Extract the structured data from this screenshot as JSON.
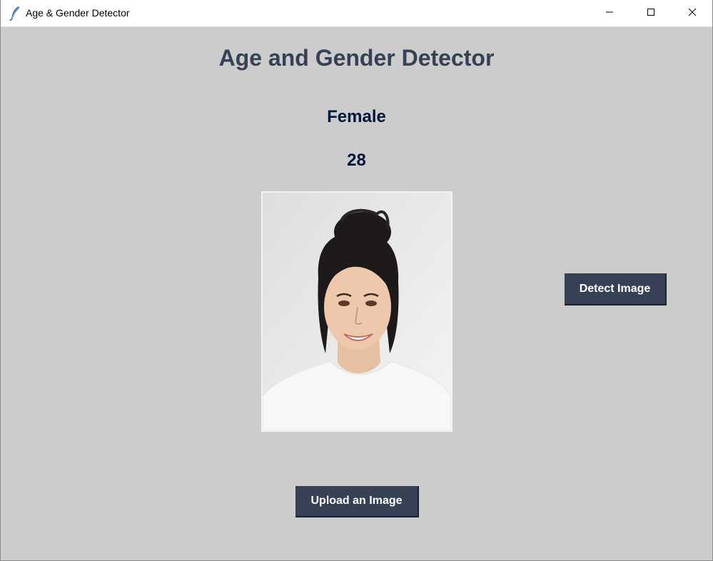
{
  "window": {
    "title": "Age & Gender Detector",
    "controls": {
      "minimize": "minimize-icon",
      "maximize": "maximize-icon",
      "close": "close-icon"
    }
  },
  "main": {
    "heading": "Age and Gender Detector",
    "result": {
      "gender": "Female",
      "age": "28"
    },
    "detect_button_label": "Detect Image",
    "upload_button_label": "Upload an Image"
  },
  "colors": {
    "background": "#cccccc",
    "heading": "#364156",
    "result_text": "#011638",
    "button_bg": "#364156",
    "button_text": "#ffffff"
  }
}
